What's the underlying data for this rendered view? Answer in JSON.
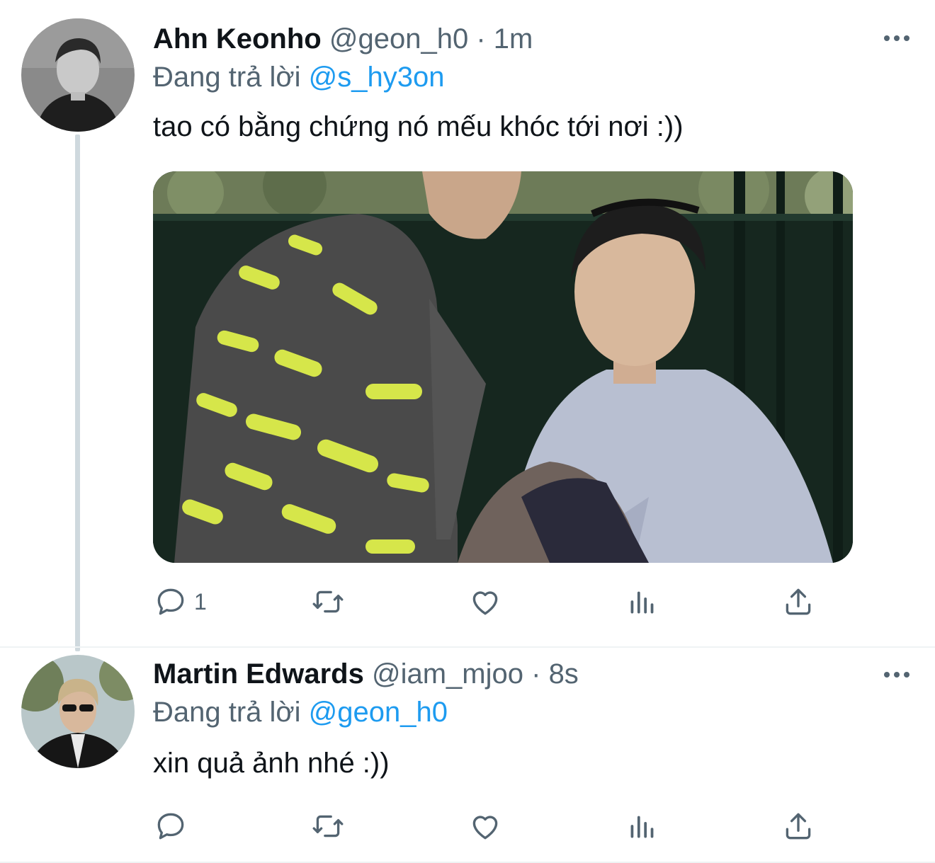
{
  "tweets": [
    {
      "display_name": "Ahn Keonho",
      "handle": "@geon_h0",
      "separator": "·",
      "time": "1m",
      "reply_prefix": "Đang trả lời",
      "reply_to": "@s_hy3on",
      "text": "tao có bằng chứng nó mếu khóc tới nơi :))",
      "has_media": true,
      "actions": {
        "reply_count": "1",
        "retweet_count": "",
        "like_count": "",
        "views_count": ""
      }
    },
    {
      "display_name": "Martin Edwards",
      "handle": "@iam_mjoo",
      "separator": "·",
      "time": "8s",
      "reply_prefix": "Đang trả lời",
      "reply_to": "@geon_h0",
      "text": "xin quả ảnh nhé :))",
      "has_media": false,
      "actions": {
        "reply_count": "",
        "retweet_count": "",
        "like_count": "",
        "views_count": ""
      }
    }
  ],
  "icons": [
    "more-icon",
    "reply-icon",
    "retweet-icon",
    "like-icon",
    "views-icon",
    "share-icon"
  ],
  "colors": {
    "text_primary": "#0f1419",
    "text_secondary": "#536471",
    "link": "#1d9bf0",
    "thread_line": "#cfd9de"
  }
}
